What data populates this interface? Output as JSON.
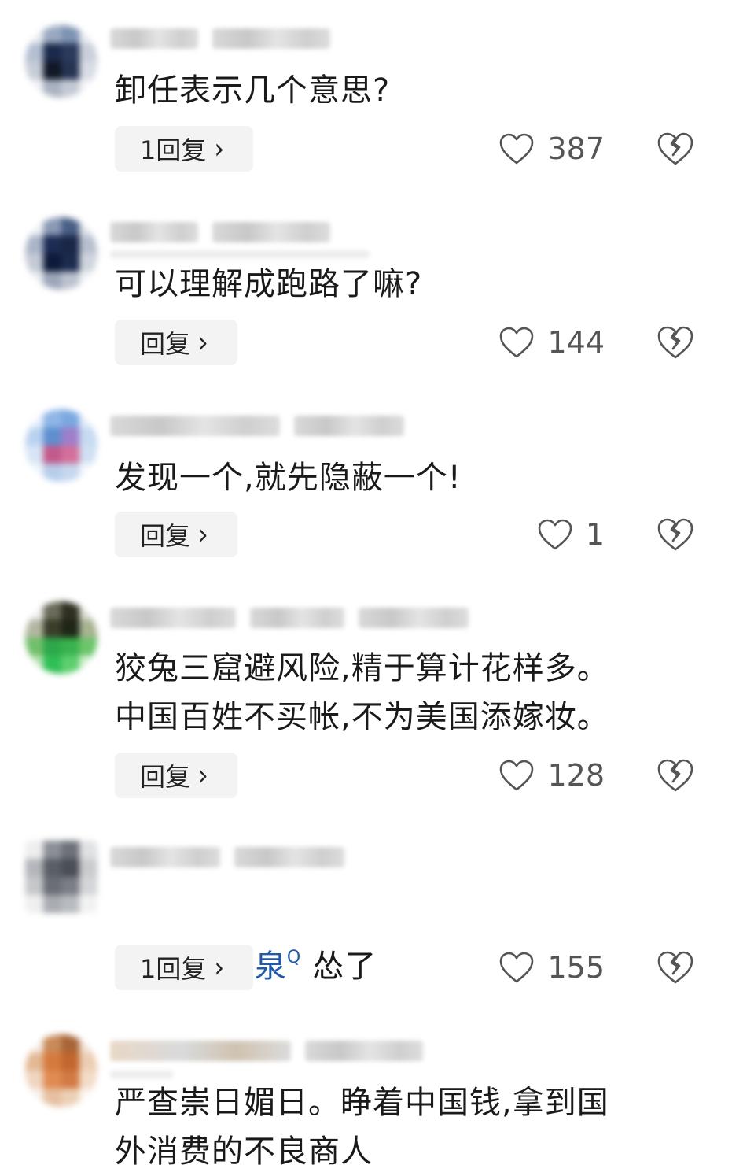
{
  "comments": [
    {
      "text": "卸任表示几个意思?",
      "reply_label": "1回复",
      "like_count": "387",
      "avatar_colors": [
        "#e9ecef",
        "#9aa9c0",
        "#7e93b3",
        "#e6e8ec",
        "#b3bfd2",
        "#1b2a4a",
        "#2a3a5c",
        "#c9d0db",
        "#c7ccd6",
        "#111827",
        "#263352",
        "#d8dce3",
        "#eef0f3",
        "#aab3c2",
        "#c4cad4",
        "#f2f3f5"
      ]
    },
    {
      "text": "可以理解成跑路了嘛?",
      "reply_label": "回复",
      "like_count": "144",
      "avatar_colors": [
        "#eef0f3",
        "#8a99b4",
        "#4a5f86",
        "#dde1e8",
        "#aab5c8",
        "#1c2c54",
        "#1a2747",
        "#b8c0cf",
        "#c4cad6",
        "#0f1a3a",
        "#1c2a4e",
        "#cfd4dd",
        "#e9ebee",
        "#9da7ba",
        "#bcc3cf",
        "#eff1f3"
      ]
    },
    {
      "text": "发现一个,就先隐蔽一个!",
      "reply_label": "回复",
      "like_count": "1",
      "avatar_colors": [
        "#e7f0fb",
        "#8fb6e6",
        "#7aa8e0",
        "#e3ecf8",
        "#b9d2f0",
        "#5f8fd0",
        "#9e7fc9",
        "#c6daf1",
        "#d7e5f6",
        "#c35a8a",
        "#d46f9b",
        "#cfe0f3",
        "#eef4fb",
        "#b7cdea",
        "#c5d8ef",
        "#f3f7fc"
      ]
    },
    {
      "text": "狡兔三窟避风险,精于算计花样多。\n中国百姓不买帐,不为美国添嫁妆。",
      "reply_label": "回复",
      "like_count": "128",
      "avatar_colors": [
        "#f0f0f0",
        "#6b6b5a",
        "#2f2f22",
        "#d8dbd0",
        "#b3b7a2",
        "#3a3d2a",
        "#1f2617",
        "#a8b392",
        "#71c06a",
        "#2ea84a",
        "#39b34e",
        "#6cc56b",
        "#b9e3b2",
        "#2fbf55",
        "#5ccf6e",
        "#d3eed0"
      ]
    },
    {
      "link_text": "农夫山泉",
      "link_marker": "Q",
      "text": "怂了",
      "reply_label": "1回复",
      "like_count": "155",
      "avatar_colors": [
        "#eeeeee",
        "#8b8f96",
        "#6d7178",
        "#e0e1e3",
        "#b3b6bb",
        "#5a5e66",
        "#4a4e55",
        "#c9cbcf",
        "#c5c7ca",
        "#6a6e75",
        "#7a7e85",
        "#d4d5d8",
        "#efefef",
        "#a9acb1",
        "#b8bbc0",
        "#f2f2f2"
      ]
    },
    {
      "text": "严查崇日媚日。睁着中国钱,拿到国\n外消费的不良商人",
      "avatar_colors": [
        "#f6efe7",
        "#c88a5a",
        "#a86536",
        "#f0e2d4",
        "#e3b894",
        "#d57a3e",
        "#c2662f",
        "#eccdb3",
        "#efd6c1",
        "#e08b52",
        "#d27a43",
        "#f2dcc8",
        "#f8f0e8",
        "#e6c0a0",
        "#ecd0b6",
        "#faf4ee"
      ]
    }
  ]
}
